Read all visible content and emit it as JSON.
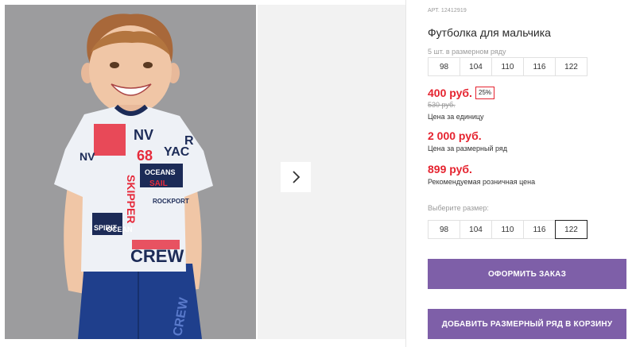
{
  "gallery": {
    "next_icon": "chevron-right-icon",
    "shirt_print": [
      "NV",
      "68",
      "YAC",
      "OCEANS",
      "SAIL",
      "ROCKPORT",
      "SKIPPER",
      "OCEAN",
      "SPIRIT",
      "CREW",
      "R",
      "Y",
      "UB"
    ],
    "jeans_print": "CREW"
  },
  "product": {
    "sku": "АРТ. 12412919",
    "title": "Футболка для мальчика",
    "size_row_note": "5 шт. в размерном ряду",
    "sizes_row": [
      "98",
      "104",
      "110",
      "116",
      "122"
    ],
    "price": "400 руб.",
    "discount": "25%",
    "old_price": "530 руб.",
    "unit_price_label": "Цена за единицу",
    "row_price": "2 000 руб.",
    "row_price_label": "Цена за размерный ряд",
    "rrp_price": "899 руб.",
    "rrp_label": "Рекомендуемая розничная цена",
    "choose_size_label": "Выберите размер:",
    "size_options": [
      "98",
      "104",
      "110",
      "116",
      "122"
    ],
    "selected_size": "122",
    "order_button": "ОФОРМИТЬ ЗАКАЗ",
    "add_row_button": "ДОБАВИТЬ РАЗМЕРНЫЙ РЯД В КОРЗИНУ"
  },
  "colors": {
    "price_red": "#e5232f",
    "button_purple": "#7e5fa8",
    "photo_background": "#9c9c9e"
  }
}
